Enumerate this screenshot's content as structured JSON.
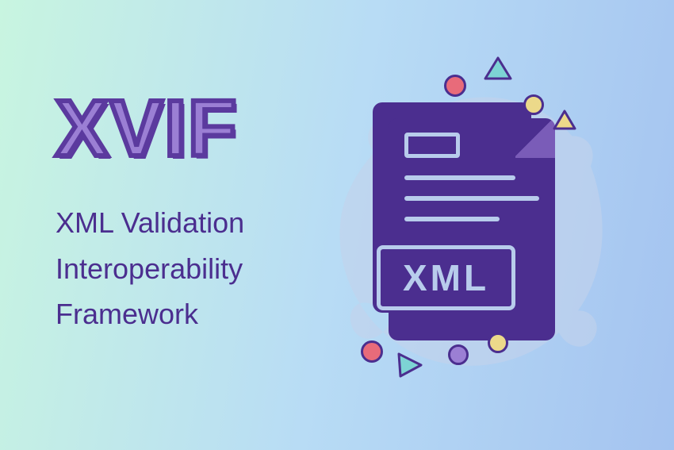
{
  "title": "XVIF",
  "subtitle_line1": "XML Validation",
  "subtitle_line2": "Interoperability",
  "subtitle_line3": "Framework",
  "xml_label": "XML"
}
